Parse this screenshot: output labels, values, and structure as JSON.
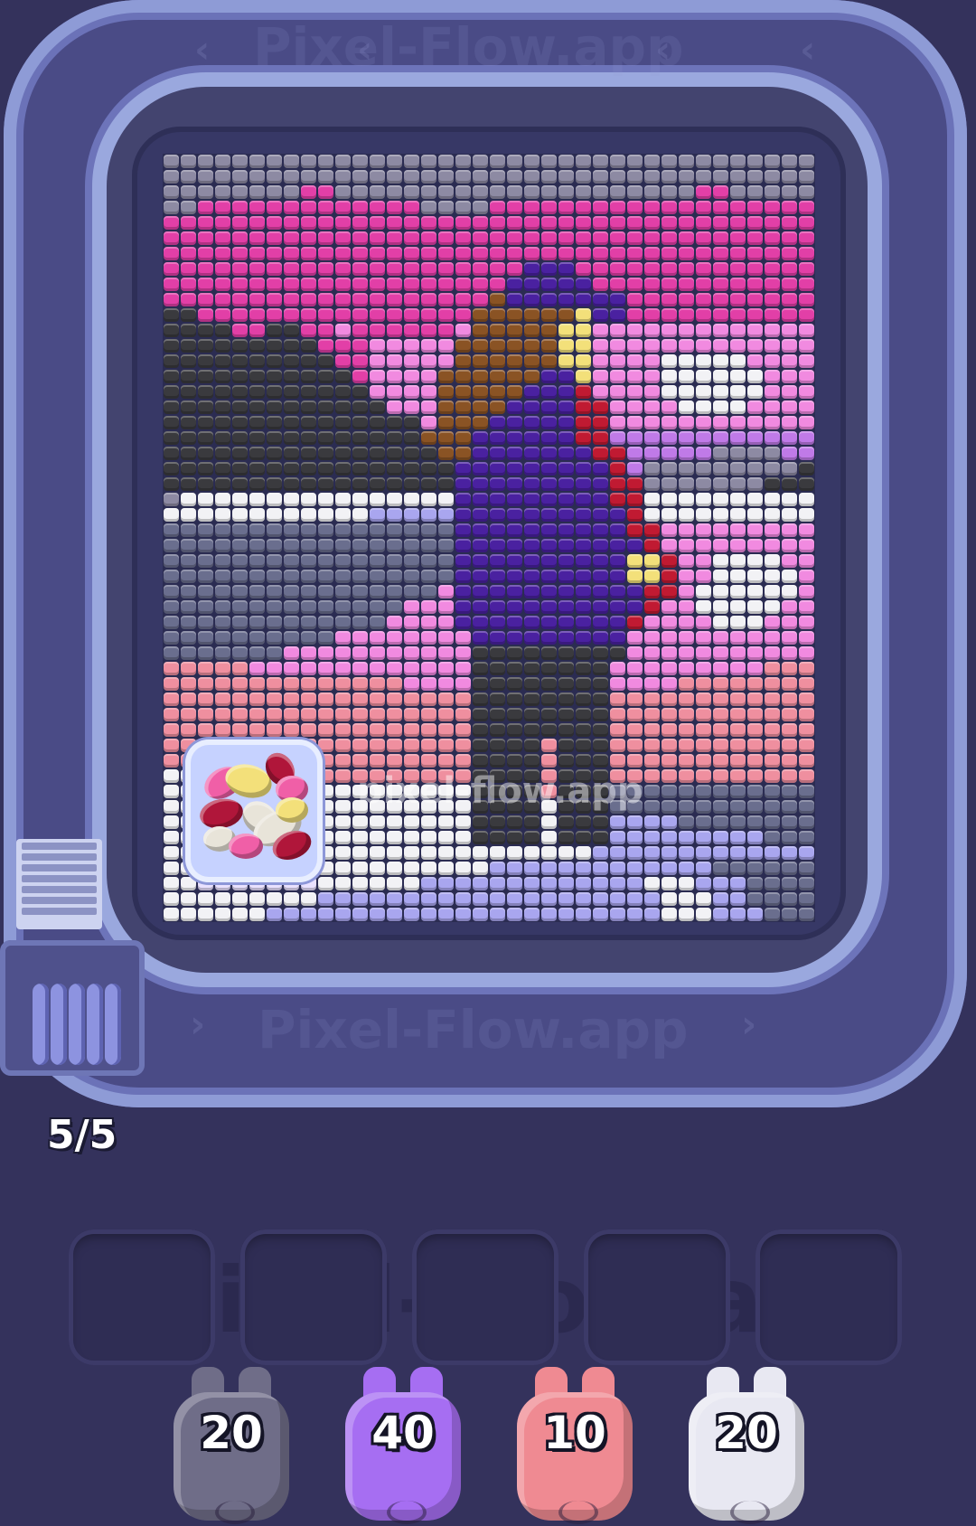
{
  "app": {
    "watermark": "Pixel-Flow.app",
    "board_watermark": "pixel-flow.app"
  },
  "conveyor": {
    "capacity_counter": "5/5",
    "rollers": 5
  },
  "board": {
    "columns": 38,
    "rows": 50,
    "palette": {
      "G": "#8d8aa3",
      "P": "#e23fa7",
      "L": "#f18ae0",
      "V": "#c07ae8",
      "D": "#3a3a3e",
      "W": "#f2f2f5",
      "B": "#a9a6ef",
      "M": "#6a6e8e",
      "S": "#ef8f9f",
      "U": "#4a21a0",
      "N": "#8a5324",
      "Y": "#f3e07a",
      "R": "#c01a32",
      "K": "#e9e1ff"
    }
  },
  "candy_bag": {
    "colors": [
      "#e8e4d9",
      "#b0163a",
      "#f05fa7",
      "#f3e07a"
    ]
  },
  "slots": [
    {
      "id": 1,
      "content": ""
    },
    {
      "id": 2,
      "content": ""
    },
    {
      "id": 3,
      "content": ""
    },
    {
      "id": 4,
      "content": ""
    },
    {
      "id": 5,
      "content": ""
    }
  ],
  "shooters": [
    {
      "count": "20",
      "color": "#6f6d88",
      "color_name": "gray"
    },
    {
      "count": "40",
      "color": "#a66ef2",
      "color_name": "purple"
    },
    {
      "count": "10",
      "color": "#ef8a92",
      "color_name": "salmon"
    },
    {
      "count": "20",
      "color": "#e8e8f2",
      "color_name": "white"
    }
  ]
}
